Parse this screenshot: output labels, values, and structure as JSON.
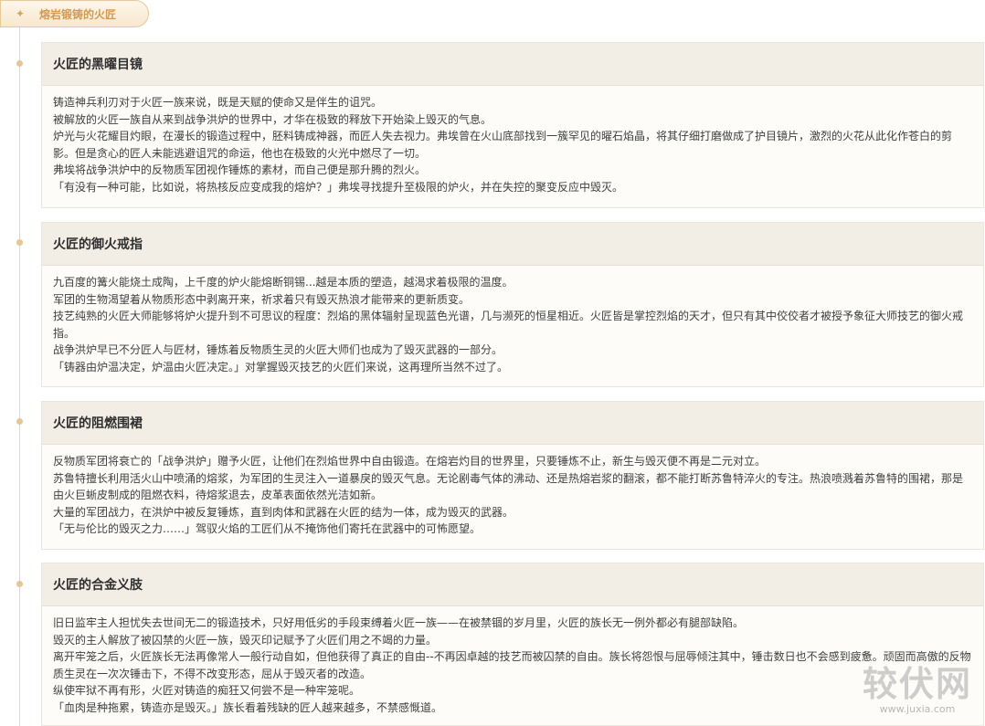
{
  "set": {
    "icon": "sparkle-icon",
    "icon_glyph": "✦",
    "title": "熔岩锻铸的火匠"
  },
  "relics": [
    {
      "name": "火匠的黑曜目镜",
      "lines": [
        "铸造神兵利刃对于火匠一族来说，既是天赋的使命又是伴生的诅咒。",
        "被解放的火匠一族自从来到战争洪炉的世界中，才华在极致的释放下开始染上毁灭的气息。",
        "炉光与火花耀目灼眼，在漫长的锻造过程中，胚料铸成神器，而匠人失去视力。弗埃曾在火山底部找到一簇罕见的曜石焰晶，将其仔细打磨做成了护目镜片，激烈的火花从此化作苍白的剪影。但是贪心的匠人未能逃避诅咒的命运，他也在极致的火光中燃尽了一切。",
        "弗埃将战争洪炉中的反物质军团视作锤炼的素材，而自己便是那升腾的烈火。",
        "「有没有一种可能，比如说，将热核反应变成我的熔炉？」弗埃寻找提升至极限的炉火，并在失控的聚变反应中毁灭。"
      ]
    },
    {
      "name": "火匠的御火戒指",
      "lines": [
        "九百度的篝火能烧土成陶，上千度的炉火能熔断铜锡...越是本质的塑造，越渴求着极限的温度。",
        "军团的生物渴望着从物质形态中剥离开来，祈求着只有毁灭热浪才能带来的更新质变。",
        "技艺纯熟的火匠大师能够将炉火提升到不可思议的程度：烈焰的黑体辐射呈现蓝色光谱，几与濒死的恒星相近。火匠皆是掌控烈焰的天才，但只有其中佼佼者才被授予象征大师技艺的御火戒指。",
        "战争洪炉早已不分匠人与匠材，锤炼着反物质生灵的火匠大师们也成为了毁灭武器的一部分。",
        "「铸器由炉温决定，炉温由火匠决定。」对掌握毁灭技艺的火匠们来说，这再理所当然不过了。"
      ]
    },
    {
      "name": "火匠的阻燃围裙",
      "lines": [
        "反物质军团将衰亡的「战争洪炉」赠予火匠，让他们在烈焰世界中自由锻造。在熔岩灼目的世界里，只要锤炼不止，新生与毁灭便不再是二元对立。",
        "苏鲁特擅长利用活火山中喷涌的熔浆，为军团的生灵注入一道暴戾的毁灭气息。无论剧毒气体的沸动、还是热熔岩浆的翻滚，都不能打断苏鲁特淬火的专注。热浪喷溅着苏鲁特的围裙，那是由火巨蜥皮制成的阻燃衣料，待熔浆退去，皮革表面依然光洁如新。",
        "大量的军团战力，在洪炉中被反复锤炼，直到肉体和武器在火匠的结为一体，成为毁灭的武器。",
        "「无与伦比的毁灭之力……」驾驭火焰的工匠们从不掩饰他们寄托在武器中的可怖愿望。"
      ]
    },
    {
      "name": "火匠的合金义肢",
      "lines": [
        "旧日监牢主人担忧失去世间无二的锻造技术，只好用低劣的手段束缚着火匠一族——在被禁锢的岁月里，火匠的族长无一例外都必有腿部缺陷。",
        "毁灭的主人解放了被囚禁的火匠一族，毁灭印记赋予了火匠们用之不竭的力量。",
        "离开牢笼之后，火匠族长无法再像常人一般行动自如，但他获得了真正的自由--不再因卓越的技艺而被囚禁的自由。族长将怨恨与屈辱倾注其中，锤击数日也不会感到疲惫。顽固而高傲的反物质生灵在一次次锤击下，不得不改变形态，屈从于毁灭者的改造。",
        "纵使牢狱不再有形，火匠对铸造的痴狂又何尝不是一种牢笼呢。",
        "「血肉是种拖累，铸造亦是毁灭。」族长看着残缺的匠人越来越多，不禁感慨道。"
      ]
    }
  ],
  "watermark": {
    "big": "较伏网",
    "small": "www.juxia.com"
  }
}
